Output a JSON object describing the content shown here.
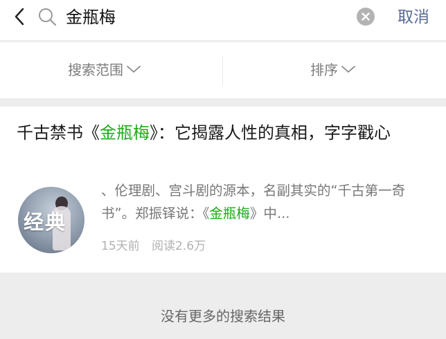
{
  "search": {
    "query": "金瓶梅",
    "cancel_label": "取消"
  },
  "filters": [
    {
      "label": "搜索范围"
    },
    {
      "label": "排序"
    }
  ],
  "result": {
    "title_before": "千古禁书《",
    "title_highlight": "金瓶梅",
    "title_after": "》：它揭露人性的真相，字字戳心",
    "snippet_before": "、伦理剧、宫斗剧的源本，名副其实的“千古第一奇书”。郑振铎说：《",
    "snippet_highlight": "金瓶梅",
    "snippet_after": "》中...",
    "thumbnail_badge": "经典",
    "time": "15天前",
    "reads": "阅读2.6万"
  },
  "footer": {
    "text": "没有更多的搜索结果"
  },
  "colors": {
    "accent_link": "#576b95",
    "highlight": "#1aad19"
  },
  "icons": [
    "back-icon",
    "search-icon",
    "clear-icon",
    "chevron-down-icon"
  ]
}
